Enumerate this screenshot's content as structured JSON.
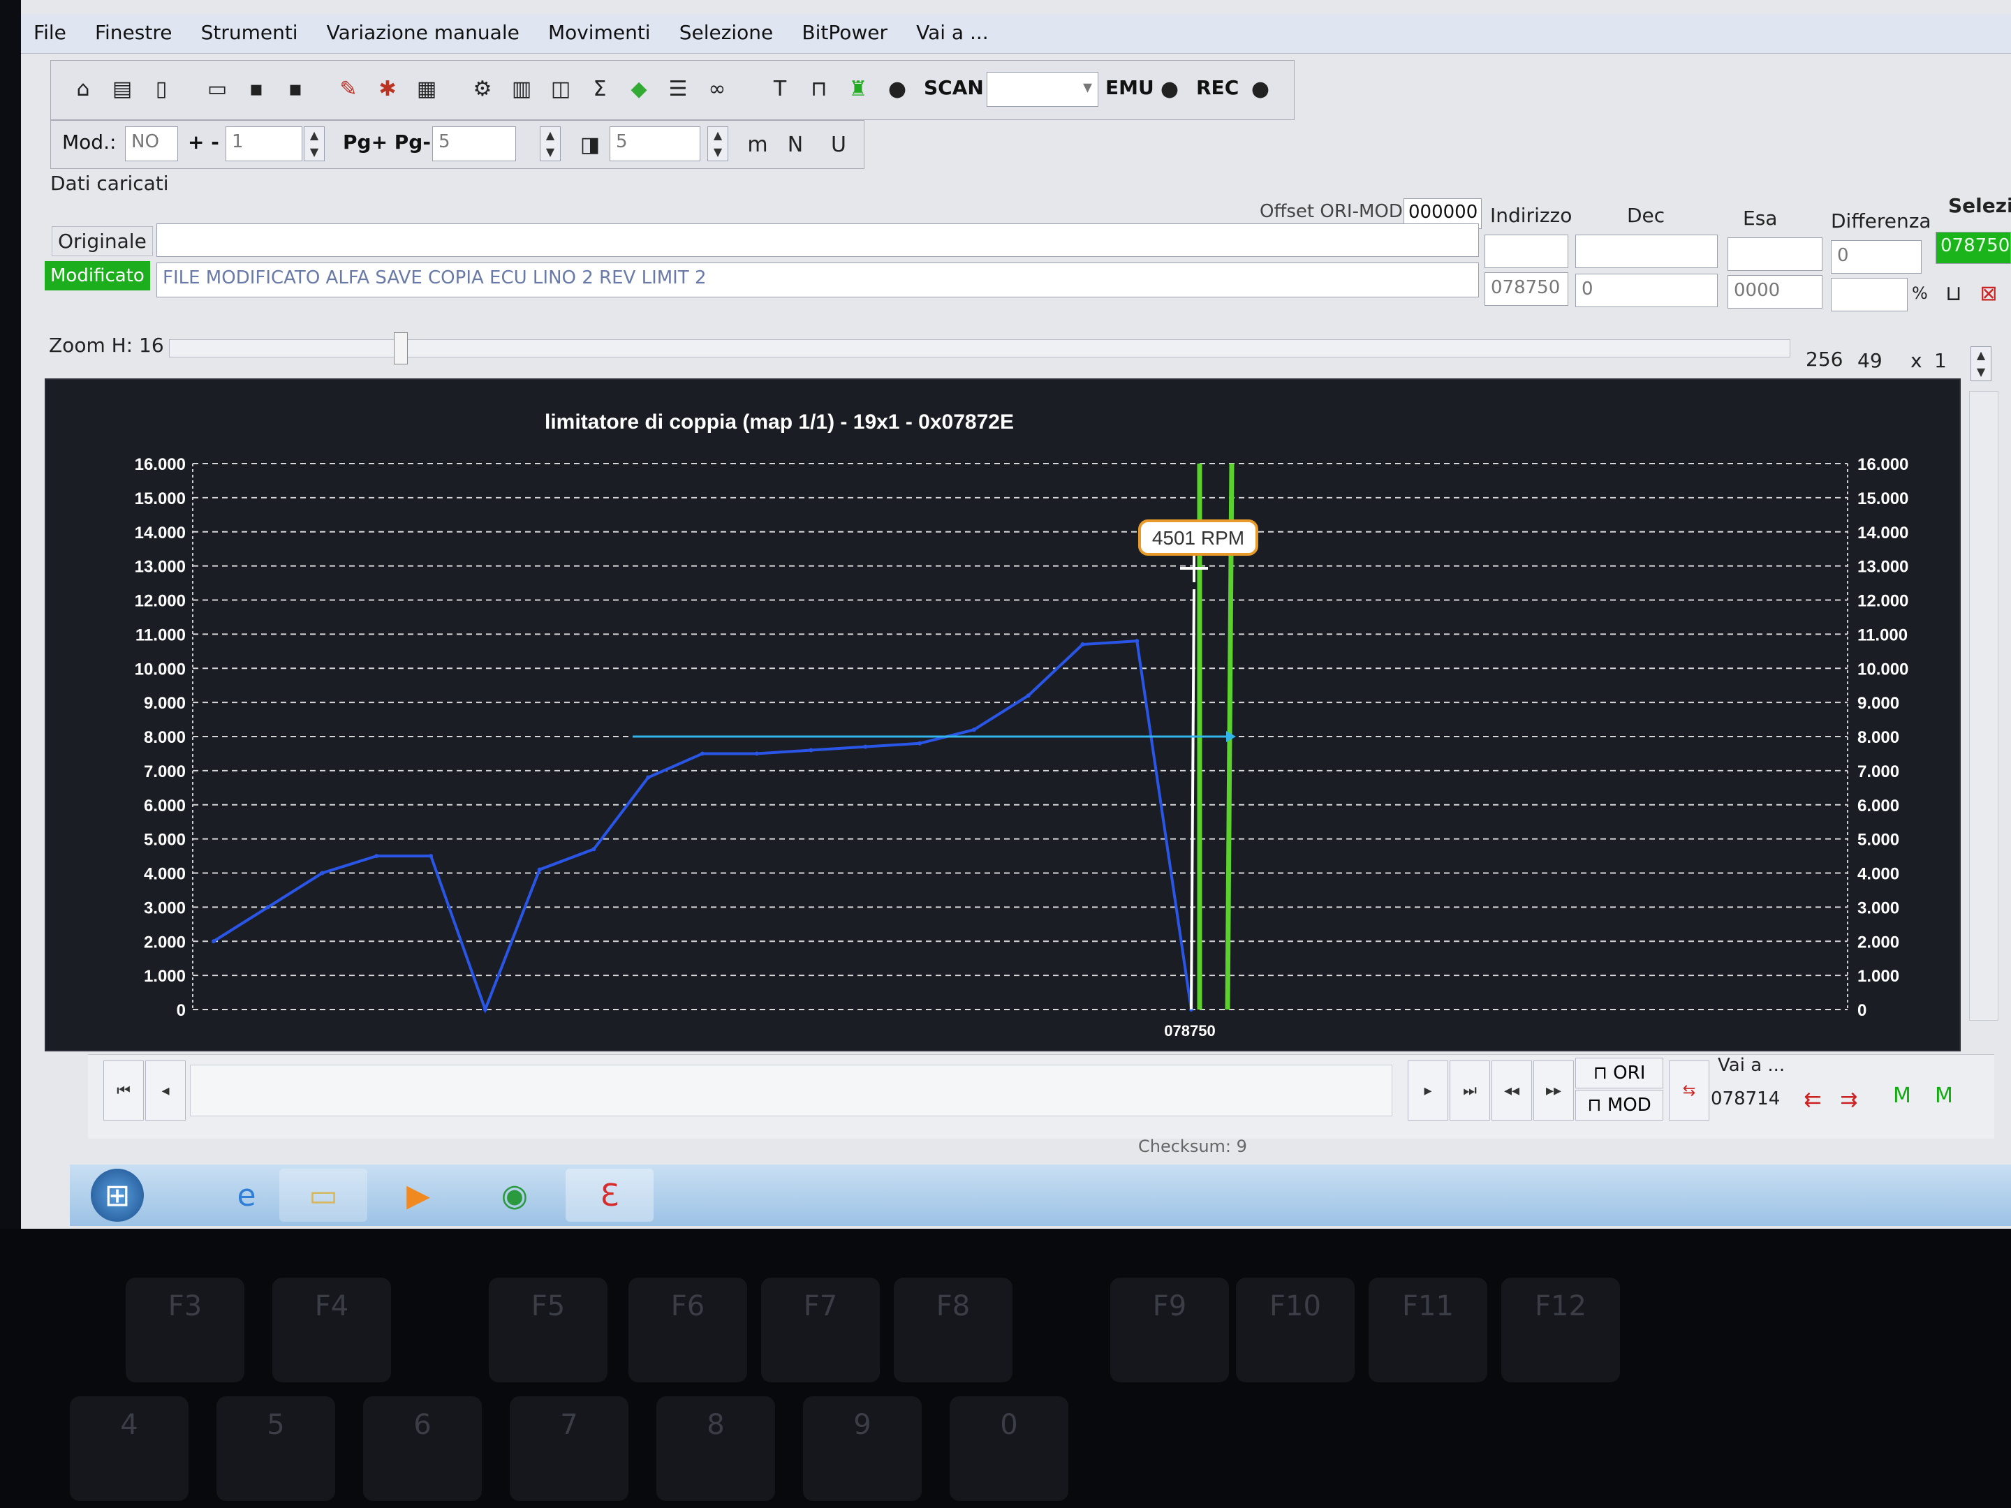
{
  "menu": [
    "File",
    "Finestre",
    "Strumenti",
    "Variazione manuale",
    "Movimenti",
    "Selezione",
    "BitPower",
    "Vai a ..."
  ],
  "toolbar": {
    "scan_label": "SCAN",
    "emu_label": "EMU",
    "rec_label": "REC"
  },
  "params": {
    "mod_label": "Mod.:",
    "mod_value": "NO",
    "plusminus_label": "+ -",
    "plusminus_value": "1",
    "pg_label": "Pg+ Pg-",
    "pg_value": "5",
    "t_value": "5"
  },
  "data_panel": {
    "title": "Dati caricati",
    "offset_label": "Offset ORI-MOD",
    "offset_value": "000000",
    "columns": [
      "Indirizzo",
      "Dec",
      "Esa",
      "Differenza"
    ],
    "selezione_label": "Selezio",
    "selezione_value": "078750",
    "originale_label": "Originale",
    "modificato_label": "Modificato",
    "modificato_file": "FILE MODIFICATO ALFA SAVE COPIA ECU LINO 2 REV LIMIT 2",
    "diff_value": "0",
    "addr_value": "078750",
    "dec_value": "0",
    "esa_value": "0000",
    "percent": "%"
  },
  "zoom": {
    "label": "Zoom H: 16",
    "v1": "256",
    "v2": "49",
    "x": "x",
    "v3": "1"
  },
  "chart_data": {
    "type": "line",
    "title": "limitatore di coppia (map 1/1) - 19x1 - 0x07872E",
    "ylim": [
      0,
      16000
    ],
    "yticks": [
      "16.000",
      "15.000",
      "14.000",
      "13.000",
      "12.000",
      "11.000",
      "10.000",
      "9.000",
      "8.000",
      "7.000",
      "6.000",
      "5.000",
      "4.000",
      "3.000",
      "2.000",
      "1.000",
      "0"
    ],
    "x_marker_label": "078750",
    "tooltip": "4501 RPM",
    "series": [
      {
        "values": [
          2000,
          3000,
          4000,
          4500,
          4500,
          0,
          4100,
          4700,
          6800,
          7500,
          7500,
          7600,
          7700,
          7800,
          8200,
          9200,
          10700,
          10800,
          0
        ]
      }
    ]
  },
  "bottom": {
    "ori_label": "ORI",
    "mod_label": "MOD",
    "vai_label": "Vai a ...",
    "vai_value": "078714",
    "checksum": "Checksum: 9"
  },
  "keys": [
    "F3",
    "F4",
    "F5",
    "F6",
    "F7",
    "F8",
    "F9",
    "F10",
    "F11",
    "F12",
    "4",
    "5",
    "6",
    "7",
    "8",
    "9",
    "0"
  ]
}
